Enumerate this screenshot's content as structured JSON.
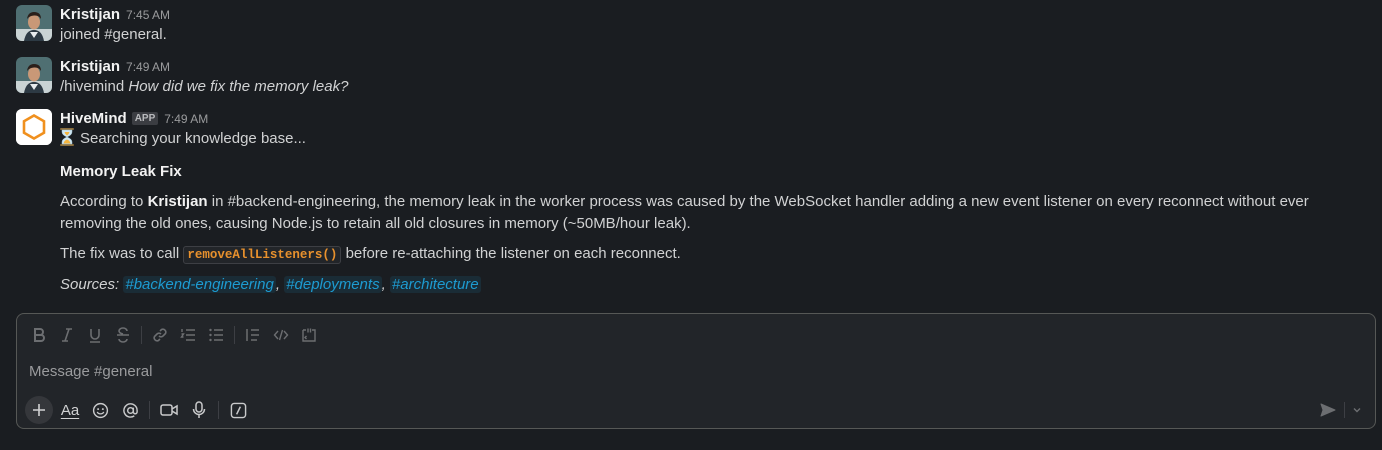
{
  "messages": [
    {
      "author": "Kristijan",
      "time": "7:45 AM",
      "text": "joined #general."
    },
    {
      "author": "Kristijan",
      "time": "7:49 AM",
      "command": "/hivemind",
      "query": "How did we fix the memory leak?"
    },
    {
      "author": "HiveMind",
      "badge": "APP",
      "time": "7:49 AM",
      "status": "Searching your knowledge base...",
      "status_icon": "hourglass",
      "heading": "Memory Leak Fix",
      "p1_prefix": "According to",
      "p1_person": "Kristijan",
      "p1_rest": "in #backend-engineering, the memory leak in the worker process was caused by the WebSocket handler adding a new event listener on every reconnect without ever removing the old ones, causing Node.js to retain all old closures in memory (~50MB/hour leak).",
      "p2_prefix": "The fix was to call",
      "p2_code": "removeAllListeners()",
      "p2_suffix": "before re-attaching the listener on each reconnect.",
      "sources_label": "Sources:",
      "sources": [
        "#backend-engineering",
        "#deployments",
        "#architecture"
      ]
    }
  ],
  "composer": {
    "placeholder": "Message #general",
    "format_icons": [
      "bold-icon",
      "italic-icon",
      "underline-icon",
      "strikethrough-icon",
      "link-icon",
      "ordered-list-icon",
      "bullet-list-icon",
      "blockquote-icon",
      "code-icon",
      "code-block-icon"
    ],
    "bottom_icons": [
      "plus-icon",
      "text-format-icon",
      "emoji-icon",
      "mention-icon",
      "video-icon",
      "microphone-icon",
      "slash-command-icon"
    ],
    "text_format_label": "Aa"
  },
  "colors": {
    "background": "#1a1d21",
    "link": "#1d9bd1",
    "code": "#e8912d",
    "hivemind_logo": "#f0901e"
  }
}
